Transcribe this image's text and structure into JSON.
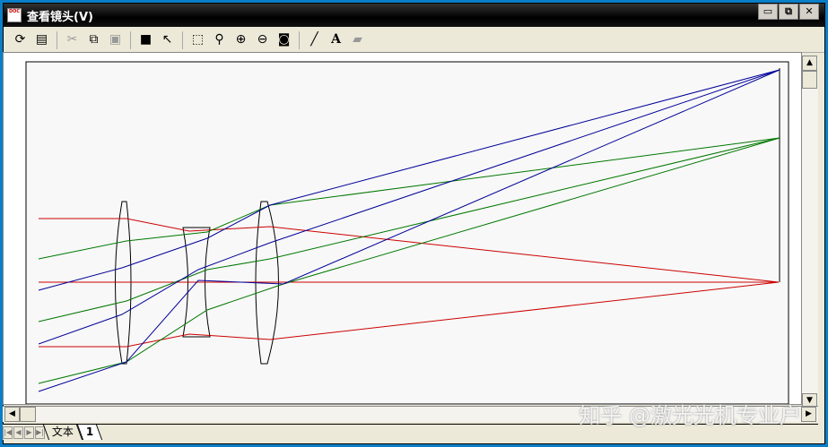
{
  "window": {
    "title": "查看镜头(V)",
    "minimize": "▭",
    "restore": "⧉",
    "close": "✕"
  },
  "toolbar": {
    "icons": [
      "refresh-icon",
      "settings-icon",
      "cut-icon",
      "copy-icon",
      "paste-icon",
      "save-icon",
      "pointer-icon",
      "zoom-box-icon",
      "zoom-pan-icon",
      "zoom-in-icon",
      "zoom-out-icon",
      "zoom-fit-icon",
      "line-icon",
      "text-icon",
      "eraser-icon"
    ]
  },
  "tabs": {
    "items": [
      "文本",
      "1"
    ]
  },
  "watermark": "知乎 @激光光机专业户",
  "colors": {
    "red": "#cc0000",
    "green": "#007700",
    "blue": "#000099"
  }
}
